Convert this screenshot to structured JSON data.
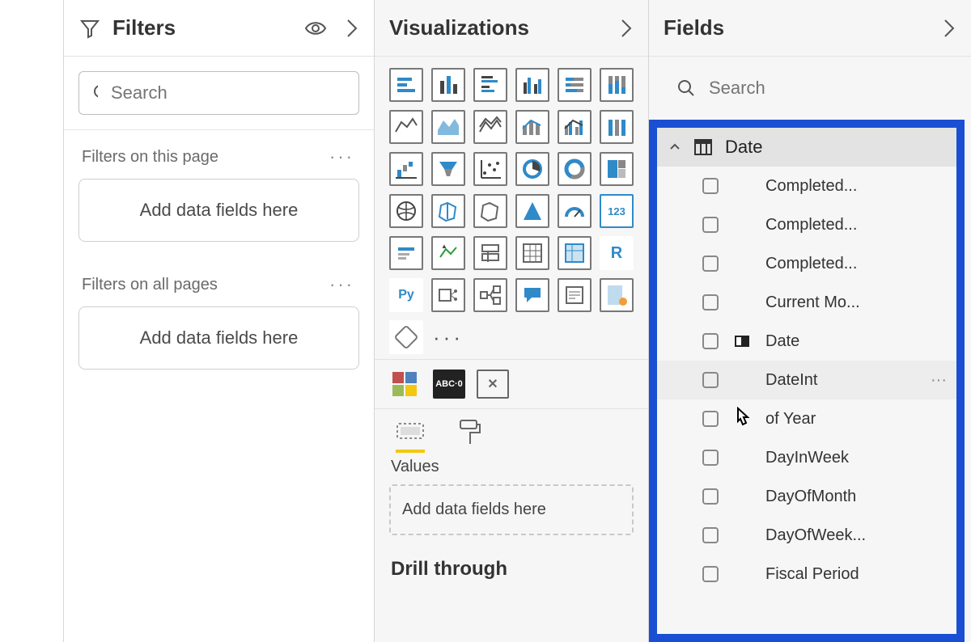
{
  "filters": {
    "title": "Filters",
    "search_placeholder": "Search",
    "this_page_label": "Filters on this page",
    "all_pages_label": "Filters on all pages",
    "drop_hint": "Add data fields here"
  },
  "viz": {
    "title": "Visualizations",
    "values_label": "Values",
    "drop_hint": "Add data fields here",
    "drill_label": "Drill through"
  },
  "fields": {
    "title": "Fields",
    "search_placeholder": "Search",
    "table_name": "Date",
    "items": [
      {
        "label": "Completed...",
        "icon": ""
      },
      {
        "label": "Completed...",
        "icon": ""
      },
      {
        "label": "Completed...",
        "icon": ""
      },
      {
        "label": "Current Mo...",
        "icon": ""
      },
      {
        "label": "Date",
        "icon": "hierarchy"
      },
      {
        "label": "DateInt",
        "icon": "",
        "hover": true
      },
      {
        "label": "of Year",
        "icon": "",
        "cursor": true
      },
      {
        "label": "DayInWeek",
        "icon": ""
      },
      {
        "label": "DayOfMonth",
        "icon": ""
      },
      {
        "label": "DayOfWeek...",
        "icon": ""
      },
      {
        "label": "Fiscal Period",
        "icon": ""
      }
    ]
  }
}
